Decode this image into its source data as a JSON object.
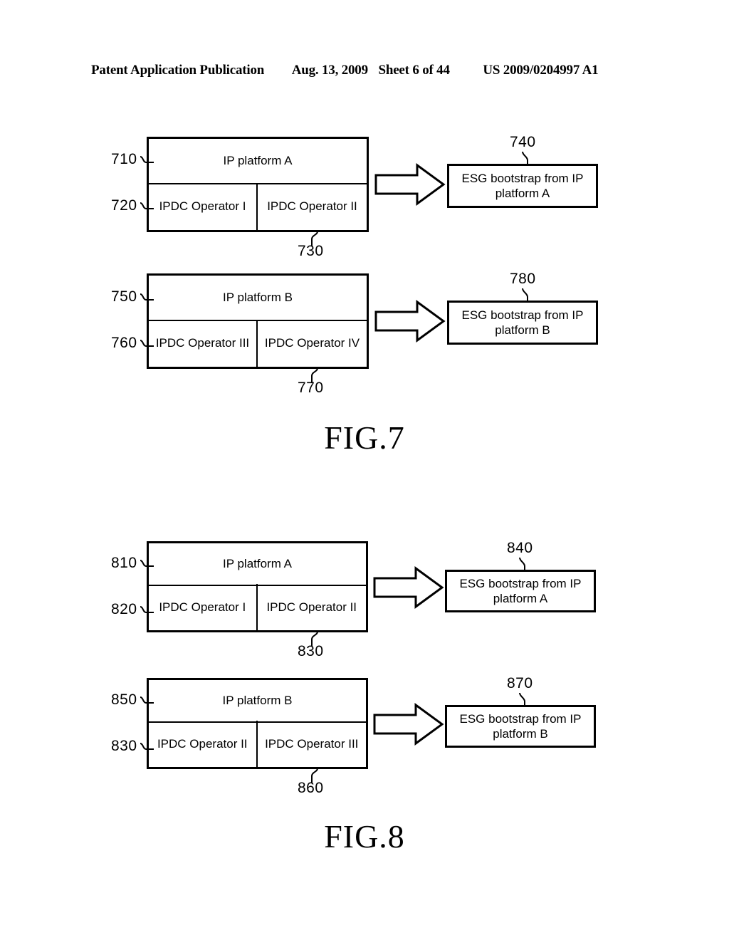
{
  "header": {
    "publication": "Patent Application Publication",
    "date": "Aug. 13, 2009",
    "sheet": "Sheet 6 of 44",
    "patent_number": "US 2009/0204997 A1"
  },
  "figures": [
    {
      "caption": "FIG.7",
      "groups": [
        {
          "platform_title": "IP platform A",
          "platform_ref": "710",
          "operator_ref": "720",
          "split_ref": "730",
          "operators": [
            "IPDC Operator I",
            "IPDC Operator II"
          ],
          "result_text": "ESG bootstrap from IP platform A",
          "result_line1": "ESG bootstrap from IP",
          "result_line2": "platform A",
          "result_ref": "740"
        },
        {
          "platform_title": "IP platform B",
          "platform_ref": "750",
          "operator_ref": "760",
          "split_ref": "770",
          "operators": [
            "IPDC Operator III",
            "IPDC Operator IV"
          ],
          "result_text": "ESG bootstrap from IP platform B",
          "result_line1": "ESG bootstrap from IP",
          "result_line2": "platform B",
          "result_ref": "780"
        }
      ]
    },
    {
      "caption": "FIG.8",
      "groups": [
        {
          "platform_title": "IP platform A",
          "platform_ref": "810",
          "operator_ref": "820",
          "split_ref": "830",
          "operators": [
            "IPDC Operator I",
            "IPDC Operator II"
          ],
          "result_text": "ESG bootstrap from IP platform A",
          "result_line1": "ESG bootstrap from IP",
          "result_line2": "platform A",
          "result_ref": "840"
        },
        {
          "platform_title": "IP platform B",
          "platform_ref": "850",
          "operator_ref": "830",
          "split_ref": "860",
          "operators": [
            "IPDC Operator II",
            "IPDC Operator III"
          ],
          "result_text": "ESG bootstrap from IP platform B",
          "result_line1": "ESG bootstrap from IP",
          "result_line2": "platform B",
          "result_ref": "870"
        }
      ]
    }
  ],
  "colors": {
    "ink": "#000000",
    "paper": "#ffffff"
  }
}
